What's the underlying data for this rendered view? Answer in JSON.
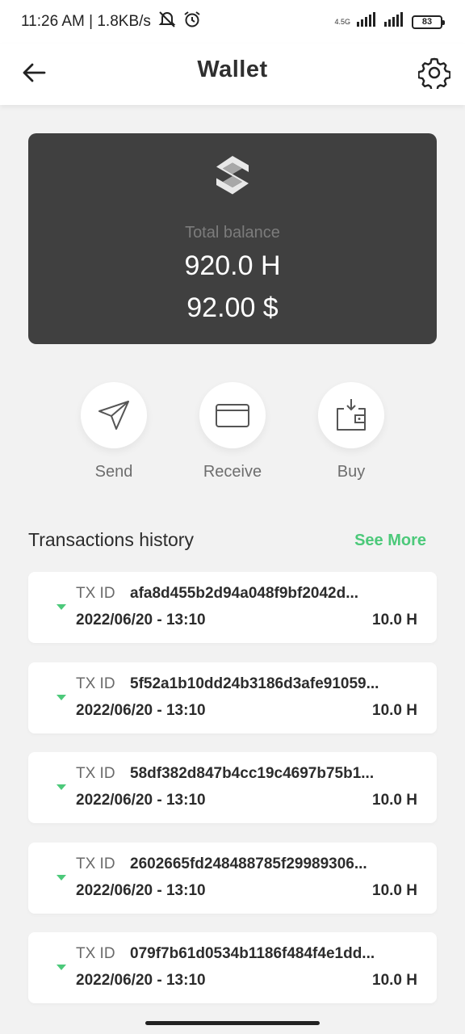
{
  "status_bar": {
    "time_speed": "11:26 AM | 1.8KB/s",
    "network": "4.5G",
    "battery": "83"
  },
  "header": {
    "title": "Wallet"
  },
  "balance": {
    "label": "Total balance",
    "amount_h": "920.0 H",
    "amount_usd": "92.00 $"
  },
  "actions": [
    {
      "label": "Send",
      "icon": "send-icon"
    },
    {
      "label": "Receive",
      "icon": "card-icon"
    },
    {
      "label": "Buy",
      "icon": "wallet-icon"
    }
  ],
  "transactions": {
    "title": "Transactions history",
    "see_more": "See More",
    "id_label": "TX ID",
    "items": [
      {
        "tx_id": "afa8d455b2d94a048f9bf2042d...",
        "date": "2022/06/20 - 13:10",
        "amount": "10.0 H"
      },
      {
        "tx_id": "5f52a1b10dd24b3186d3afe91059...",
        "date": "2022/06/20 - 13:10",
        "amount": "10.0 H"
      },
      {
        "tx_id": "58df382d847b4cc19c4697b75b1...",
        "date": "2022/06/20 - 13:10",
        "amount": "10.0 H"
      },
      {
        "tx_id": "2602665fd248488785f29989306...",
        "date": "2022/06/20 - 13:10",
        "amount": "10.0 H"
      },
      {
        "tx_id": "079f7b61d0534b1186f484f4e1dd...",
        "date": "2022/06/20 - 13:10",
        "amount": "10.0 H"
      }
    ]
  },
  "colors": {
    "accent": "#4cc97a",
    "card": "#404040",
    "background": "#f2f2f2"
  }
}
